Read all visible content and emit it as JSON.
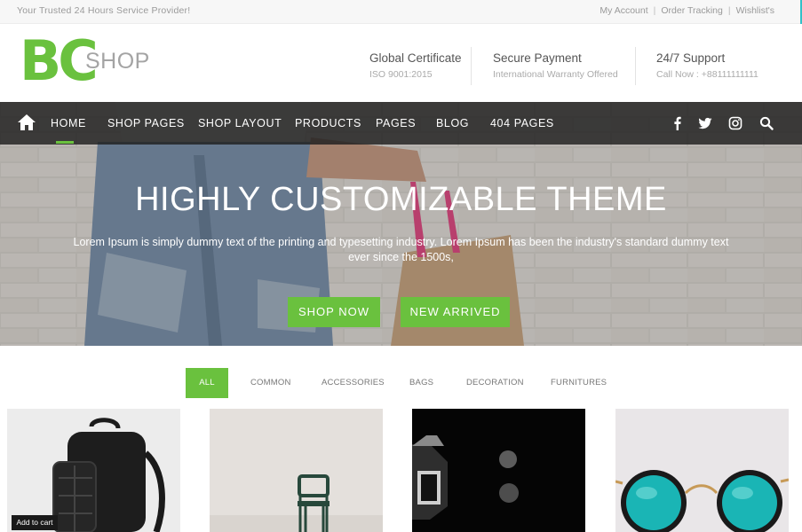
{
  "topbar": {
    "tagline": "Your Trusted 24 Hours Service Provider!",
    "links": [
      "My Account",
      "Order Tracking",
      "Wishlist's"
    ],
    "separator": "|"
  },
  "logo": {
    "mark": "BC",
    "text": "SHOP",
    "color": "#6ac13e"
  },
  "header_info": [
    {
      "title": "Global Certificate",
      "subtitle": "ISO 9001:2015"
    },
    {
      "title": "Secure Payment",
      "subtitle": "International Warranty Offered"
    },
    {
      "title": "24/7 Support",
      "subtitle": "Call Now : +88111111111"
    }
  ],
  "nav": {
    "items": [
      "HOME",
      "SHOP PAGES",
      "SHOP LAYOUT",
      "PRODUCTS",
      "PAGES",
      "BLOG",
      "404 PAGES"
    ],
    "active": "HOME",
    "social_icons": [
      "facebook-icon",
      "twitter-icon",
      "instagram-icon",
      "search-icon"
    ]
  },
  "hero": {
    "title": "HIGHLY CUSTOMIZABLE THEME",
    "text": "Lorem Ipsum is simply dummy text of the printing and typesetting industry. Lorem Ipsum has been the industry's standard dummy text ever since the 1500s,",
    "buttons": [
      "SHOP NOW",
      "NEW ARRIVED"
    ]
  },
  "filters": {
    "items": [
      "ALL",
      "COMMON",
      "ACCESSORIES",
      "BAGS",
      "DECORATION",
      "FURNITURES"
    ],
    "active": "ALL"
  },
  "products": {
    "add_to_cart": "Add to cart",
    "images": [
      "backpack",
      "chair",
      "lamp",
      "sunglasses"
    ]
  },
  "colors": {
    "accent": "#6ac13e",
    "nav_bg": "#2a2a2a"
  }
}
